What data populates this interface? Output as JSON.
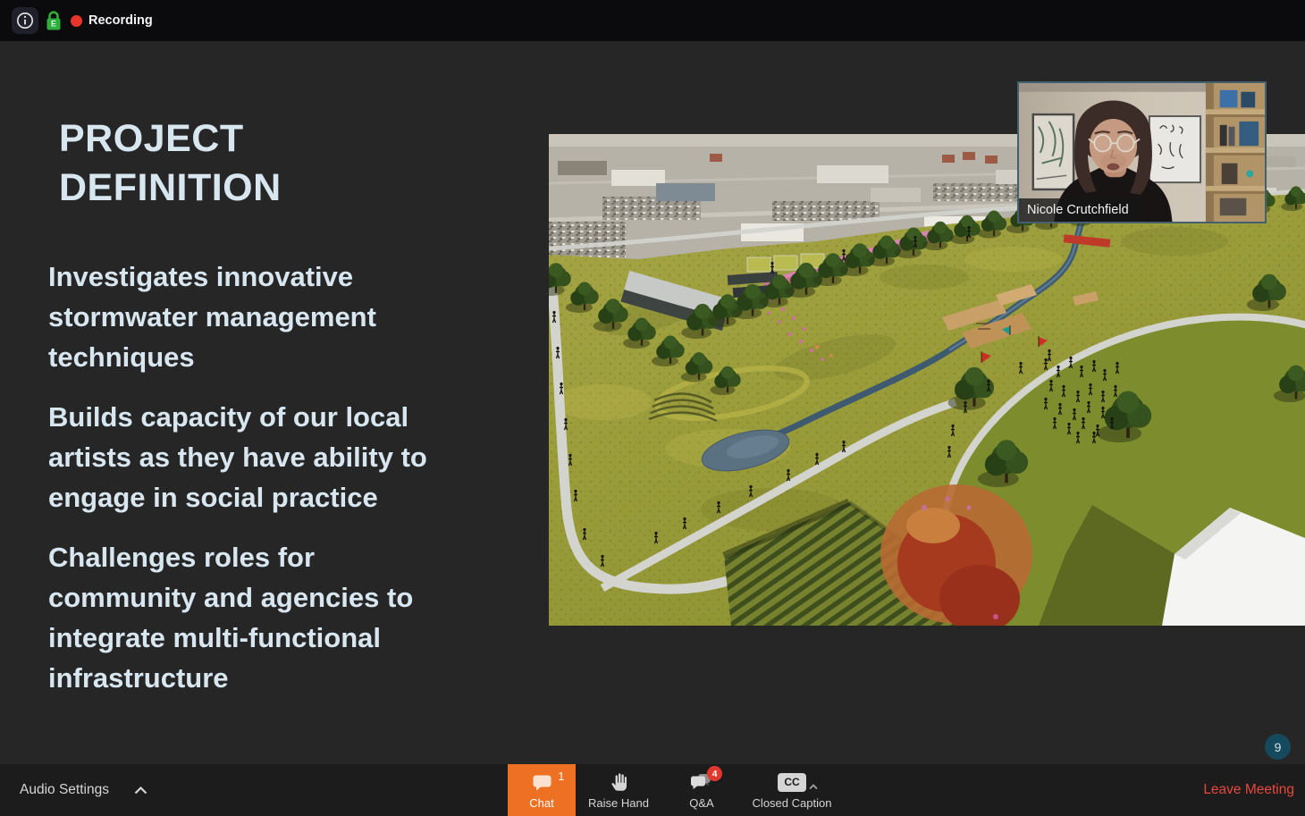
{
  "top_bar": {
    "recording_label": "Recording"
  },
  "slide": {
    "title": "PROJECT\nDEFINITION",
    "bullets": [
      "Investigates innovative\nstormwater management\ntechniques",
      "Builds capacity of our local\nartists as they have ability to\nengage in social practice",
      "Challenges roles for\ncommunity and agencies to\nintegrate multi-functional\ninfrastructure"
    ],
    "image_alt": "Aerial rendering of a proposed park: rolling yellow-green meadow with walking paths, tree rows, a winding stream and pond, community lawn with crowd, crop rows, flowering mounds and buildings beside a gray commercial district"
  },
  "video_tile": {
    "participant_name": "Nicole Crutchfield"
  },
  "participants_badge": "9",
  "toolbar": {
    "audio_settings_label": "Audio Settings",
    "chat": {
      "label": "Chat",
      "badge": "1"
    },
    "raise_hand": {
      "label": "Raise Hand"
    },
    "qa": {
      "label": "Q&A",
      "badge": "4"
    },
    "closed_caption": {
      "label": "Closed Caption"
    },
    "leave_label": "Leave Meeting"
  },
  "colors": {
    "accent_orange": "#ED7023",
    "leave_red": "#E8483C",
    "recording_red": "#E8352C",
    "encryption_green": "#2FAE3C",
    "badge_red": "#E0382E",
    "participants_teal": "#15495D",
    "slide_text": "#D8E6F0"
  }
}
